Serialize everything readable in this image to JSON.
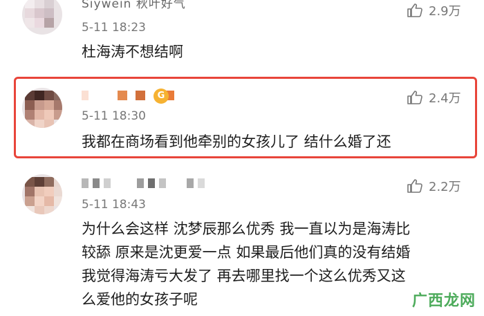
{
  "comments": [
    {
      "username": "Siywein 秋叶好气",
      "time": "5-11 18:23",
      "likes": "2.9万",
      "text": "杜海涛不想结啊"
    },
    {
      "username": "",
      "time": "5-11 18:30",
      "likes": "2.4万",
      "text": "我都在商场看到他牵别的女孩儿了 结什么婚了还",
      "badge": "G"
    },
    {
      "username": "",
      "time": "5-11 18:43",
      "likes": "2.2万",
      "text": "为什么会这样 沈梦辰那么优秀 我一直以为是海涛比\n较舔 原来是沈更爱一点 如果最后他们真的没有结婚\n我觉得海涛亏大发了 再去哪里找一个这么优秀又这\n么爱他的女孩子呢"
    }
  ],
  "watermark": "广西龙网",
  "colors": {
    "highlight_border": "#e8453a",
    "watermark": "#3aa24a"
  },
  "icons": {
    "like": "thumbs-up-icon",
    "vip": "crown-badge-icon"
  }
}
